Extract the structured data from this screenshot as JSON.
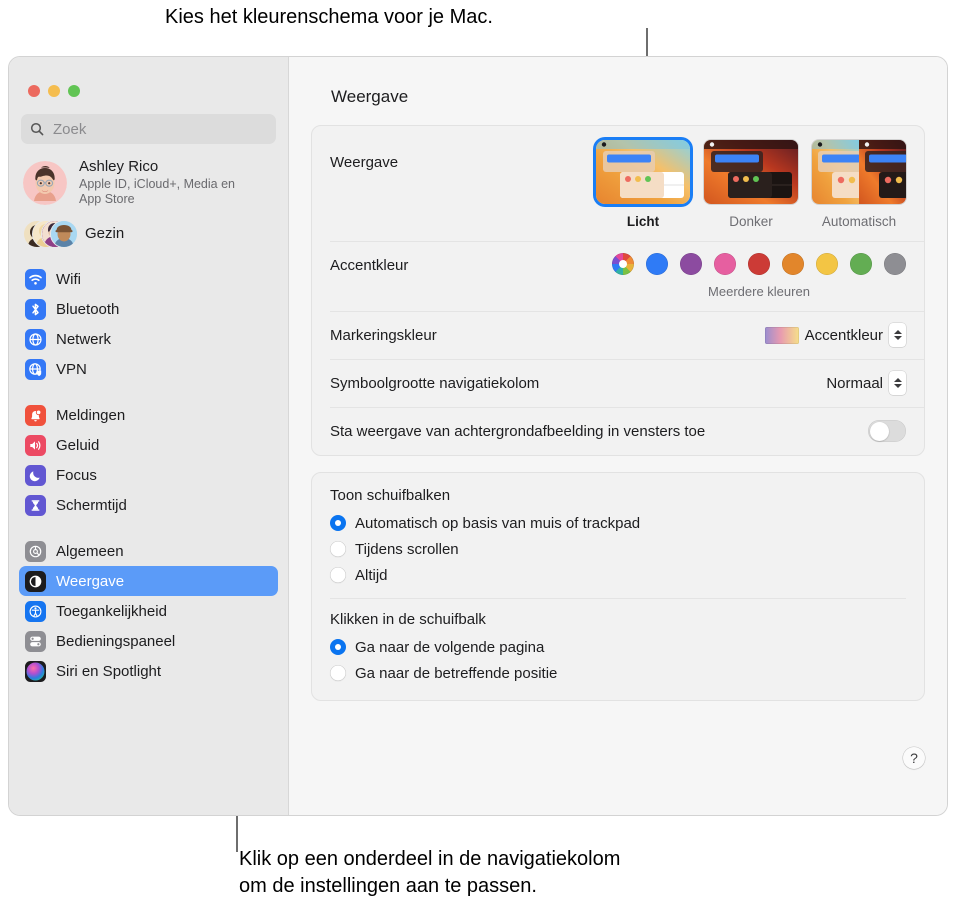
{
  "callouts": {
    "top": "Kies het kleurenschema voor je Mac.",
    "bottom": "Klik op een onderdeel in de navigatiekolom\nom de instellingen aan te passen."
  },
  "sidebar": {
    "search": {
      "placeholder": "Zoek",
      "value": "",
      "icon": "search-icon"
    },
    "account": {
      "name": "Ashley Rico",
      "subtitle": "Apple ID, iCloud+, Media en App Store",
      "avatar_icon": "memoji-avatar"
    },
    "family": {
      "label": "Gezin",
      "icon": "family-avatars"
    },
    "groups": [
      {
        "items": [
          {
            "label": "Wifi",
            "icon": "wifi-icon",
            "selected": false
          },
          {
            "label": "Bluetooth",
            "icon": "bluetooth-icon",
            "selected": false
          },
          {
            "label": "Netwerk",
            "icon": "network-globe-icon",
            "selected": false
          },
          {
            "label": "VPN",
            "icon": "vpn-globe-icon",
            "selected": false
          }
        ]
      },
      {
        "items": [
          {
            "label": "Meldingen",
            "icon": "bell-icon",
            "selected": false
          },
          {
            "label": "Geluid",
            "icon": "speaker-icon",
            "selected": false
          },
          {
            "label": "Focus",
            "icon": "moon-icon",
            "selected": false
          },
          {
            "label": "Schermtijd",
            "icon": "hourglass-icon",
            "selected": false
          }
        ]
      },
      {
        "items": [
          {
            "label": "Algemeen",
            "icon": "gear-icon",
            "selected": false
          },
          {
            "label": "Weergave",
            "icon": "appearance-icon",
            "selected": true
          },
          {
            "label": "Toegankelijkheid",
            "icon": "accessibility-icon",
            "selected": false
          },
          {
            "label": "Bedieningspaneel",
            "icon": "control-center-icon",
            "selected": false
          },
          {
            "label": "Siri en Spotlight",
            "icon": "siri-icon",
            "selected": false
          }
        ]
      }
    ]
  },
  "detail": {
    "title": "Weergave",
    "appearance": {
      "label": "Weergave",
      "options": [
        {
          "name": "Licht",
          "selected": true
        },
        {
          "name": "Donker",
          "selected": false
        },
        {
          "name": "Automatisch",
          "selected": false
        }
      ]
    },
    "accent": {
      "label": "Accentkleur",
      "caption": "Meerdere kleuren",
      "swatches": [
        {
          "name": "multicolor",
          "color": "multi"
        },
        {
          "name": "blue",
          "color": "#2f7bf6"
        },
        {
          "name": "purple",
          "color": "#8c4ba0"
        },
        {
          "name": "pink",
          "color": "#e65fa0"
        },
        {
          "name": "red",
          "color": "#cc3b36"
        },
        {
          "name": "orange",
          "color": "#e2862b"
        },
        {
          "name": "yellow",
          "color": "#f3c544"
        },
        {
          "name": "green",
          "color": "#63ad53"
        },
        {
          "name": "graphite",
          "color": "#8e8e93"
        }
      ]
    },
    "highlight": {
      "label": "Markeringskleur",
      "value": "Accentkleur"
    },
    "sidebar_icon_size": {
      "label": "Symboolgrootte navigatiekolom",
      "value": "Normaal"
    },
    "wallpaper_tinting": {
      "label": "Sta weergave van achtergrondafbeelding in vensters toe",
      "enabled": false
    },
    "show_scrollbars": {
      "heading": "Toon schuifbalken",
      "options": [
        {
          "label": "Automatisch op basis van muis of trackpad",
          "selected": true
        },
        {
          "label": "Tijdens scrollen",
          "selected": false
        },
        {
          "label": "Altijd",
          "selected": false
        }
      ]
    },
    "click_scrollbar": {
      "heading": "Klikken in de schuifbalk",
      "options": [
        {
          "label": "Ga naar de volgende pagina",
          "selected": true
        },
        {
          "label": "Ga naar de betreffende positie",
          "selected": false
        }
      ]
    },
    "help_label": "?"
  },
  "window_controls": {
    "close": "close-button",
    "minimize": "minimize-button",
    "zoom": "zoom-button"
  },
  "colors": {
    "accent": "#1a7ef5",
    "sidebar_selection": "#5b9bf8"
  }
}
